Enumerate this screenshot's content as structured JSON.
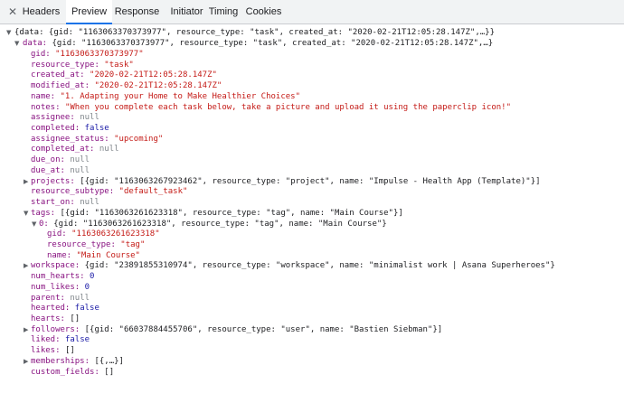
{
  "devtools": {
    "close_glyph": "✕",
    "tabs": [
      {
        "label": "Headers",
        "active": false
      },
      {
        "label": "Preview",
        "active": true
      },
      {
        "label": "Response",
        "active": false
      },
      {
        "label": "Initiator",
        "active": false
      },
      {
        "label": "Timing",
        "active": false
      },
      {
        "label": "Cookies",
        "active": false
      }
    ]
  },
  "preview": {
    "root_summary": "{data: {gid: \"1163063370373977\", resource_type: \"task\", created_at: \"2020-02-21T12:05:28.147Z\",…}}",
    "data_key": "data:",
    "data_summary": "{gid: \"1163063370373977\", resource_type: \"task\", created_at: \"2020-02-21T12:05:28.147Z\",…}",
    "rows": [
      {
        "k": "gid:",
        "v": "\"1163063370373977\"",
        "vt": "s"
      },
      {
        "k": "resource_type:",
        "v": "\"task\"",
        "vt": "s"
      },
      {
        "k": "created_at:",
        "v": "\"2020-02-21T12:05:28.147Z\"",
        "vt": "s"
      },
      {
        "k": "modified_at:",
        "v": "\"2020-02-21T12:05:28.147Z\"",
        "vt": "s"
      },
      {
        "k": "name:",
        "v": "\"1. Adapting your Home to Make Healthier Choices\"",
        "vt": "s"
      },
      {
        "k": "notes:",
        "v": "\"When you complete each task below, take a picture and upload it using the paperclip icon!\"",
        "vt": "s"
      },
      {
        "k": "assignee:",
        "v": "null",
        "vt": "n"
      },
      {
        "k": "completed:",
        "v": "false",
        "vt": "b"
      },
      {
        "k": "assignee_status:",
        "v": "\"upcoming\"",
        "vt": "s"
      },
      {
        "k": "completed_at:",
        "v": "null",
        "vt": "n"
      },
      {
        "k": "due_on:",
        "v": "null",
        "vt": "n"
      },
      {
        "k": "due_at:",
        "v": "null",
        "vt": "n"
      },
      {
        "k": "projects:",
        "v": "[{gid: \"1163063267923462\", resource_type: \"project\", name: \"Impulse - Health App (Template)\"}]",
        "vt": "p",
        "expander": "collapsed"
      },
      {
        "k": "resource_subtype:",
        "v": "\"default_task\"",
        "vt": "s"
      },
      {
        "k": "start_on:",
        "v": "null",
        "vt": "n"
      },
      {
        "k": "tags:",
        "v": "[{gid: \"1163063261623318\", resource_type: \"tag\", name: \"Main Course\"}]",
        "vt": "p",
        "expander": "expanded"
      },
      {
        "k": "0:",
        "v": "{gid: \"1163063261623318\", resource_type: \"tag\", name: \"Main Course\"}",
        "vt": "p",
        "expander": "expanded",
        "indent": 1
      },
      {
        "k": "gid:",
        "v": "\"1163063261623318\"",
        "vt": "s",
        "indent": 2
      },
      {
        "k": "resource_type:",
        "v": "\"tag\"",
        "vt": "s",
        "indent": 2
      },
      {
        "k": "name:",
        "v": "\"Main Course\"",
        "vt": "s",
        "indent": 2
      },
      {
        "k": "workspace:",
        "v": "{gid: \"23891855310974\", resource_type: \"workspace\", name: \"minimalist work | Asana Superheroes\"}",
        "vt": "p",
        "expander": "collapsed"
      },
      {
        "k": "num_hearts:",
        "v": "0",
        "vt": "b"
      },
      {
        "k": "num_likes:",
        "v": "0",
        "vt": "b"
      },
      {
        "k": "parent:",
        "v": "null",
        "vt": "n"
      },
      {
        "k": "hearted:",
        "v": "false",
        "vt": "b"
      },
      {
        "k": "hearts:",
        "v": "[]",
        "vt": "p"
      },
      {
        "k": "followers:",
        "v": "[{gid: \"66037884455706\", resource_type: \"user\", name: \"Bastien Siebman\"}]",
        "vt": "p",
        "expander": "collapsed"
      },
      {
        "k": "liked:",
        "v": "false",
        "vt": "b"
      },
      {
        "k": "likes:",
        "v": "[]",
        "vt": "p"
      },
      {
        "k": "memberships:",
        "v": "[{,…}]",
        "vt": "p",
        "expander": "collapsed"
      },
      {
        "k": "custom_fields:",
        "v": "[]",
        "vt": "p"
      }
    ]
  }
}
